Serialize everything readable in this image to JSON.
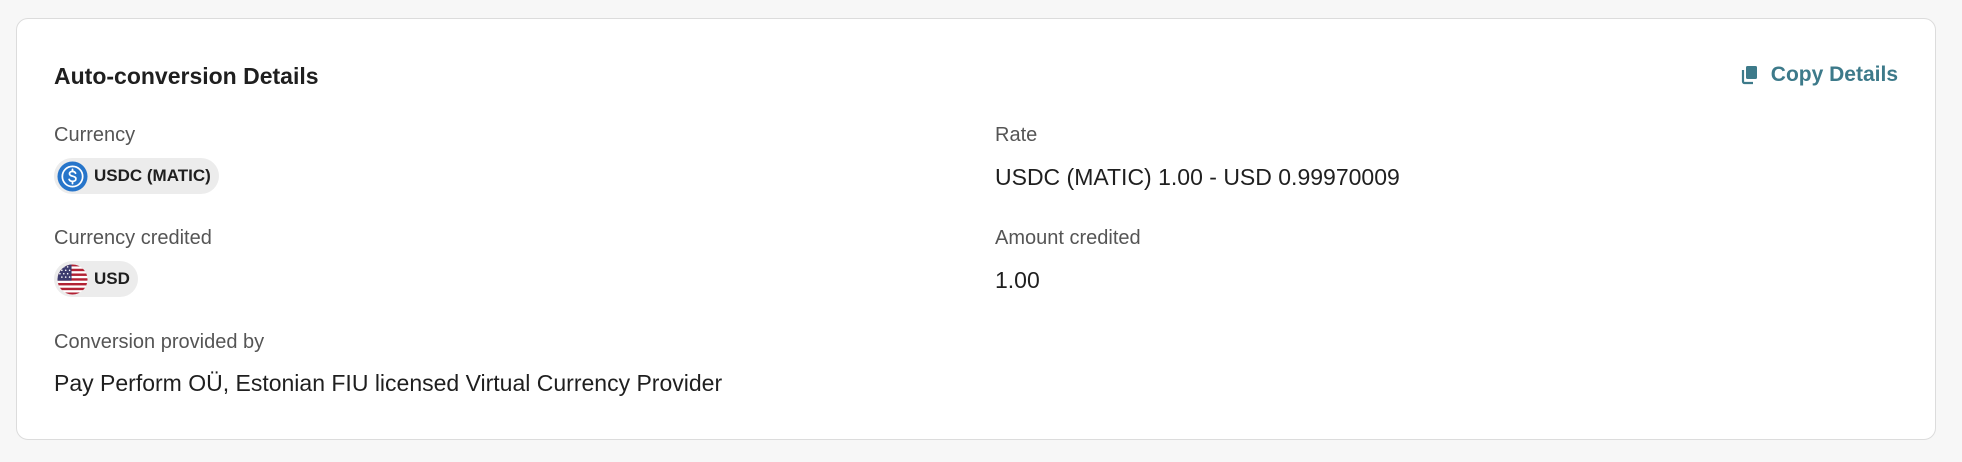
{
  "card": {
    "title": "Auto-conversion Details",
    "copy_label": "Copy Details"
  },
  "fields": {
    "currency": {
      "label": "Currency",
      "value": "USDC (MATIC)",
      "icon": "usdc-coin-icon"
    },
    "rate": {
      "label": "Rate",
      "value": "USDC (MATIC) 1.00 - USD 0.99970009"
    },
    "currency_credited": {
      "label": "Currency credited",
      "value": "USD",
      "icon": "us-flag-icon"
    },
    "amount_credited": {
      "label": "Amount credited",
      "value": "1.00"
    },
    "provider": {
      "label": "Conversion provided by",
      "value": "Pay Perform OÜ, Estonian FIU licensed Virtual Currency Provider"
    }
  },
  "colors": {
    "accent": "#3d7a8a",
    "usdc_blue": "#2775ca"
  }
}
